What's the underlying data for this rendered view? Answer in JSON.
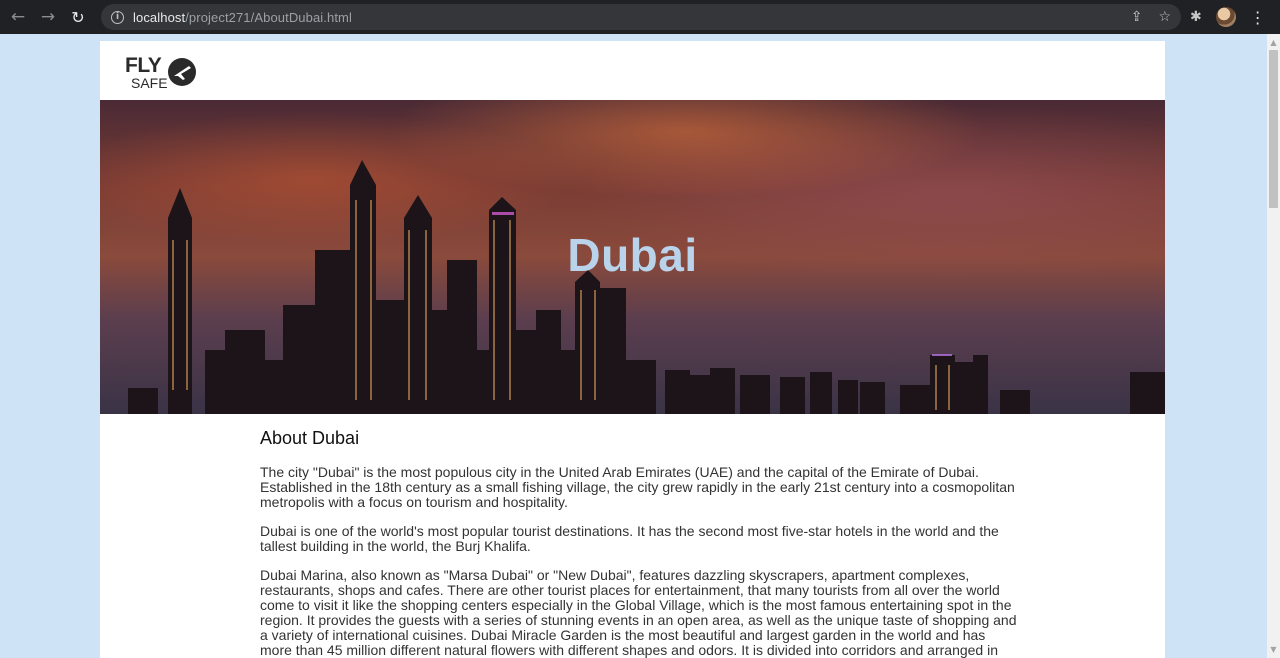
{
  "browser": {
    "url_host": "localhost",
    "url_path": "/project271/AboutDubai.html",
    "icons": {
      "back": "arrow-left-icon",
      "forward": "arrow-right-icon",
      "reload": "reload-icon",
      "info": "info-icon",
      "share": "share-icon",
      "bookmark": "star-icon",
      "extensions": "puzzle-icon",
      "menu": "kebab-menu-icon"
    }
  },
  "logo": {
    "line1": "FLY",
    "line2": "SAFE"
  },
  "hero": {
    "title": "Dubai"
  },
  "about": {
    "heading": "About Dubai",
    "paragraphs": [
      "The city \"Dubai\" is the most populous city in the United Arab Emirates (UAE) and the capital of the Emirate of Dubai. Established in the 18th century as a small fishing village, the city grew rapidly in the early 21st century into a cosmopolitan metropolis with a focus on tourism and hospitality.",
      "Dubai is one of the world's most popular tourist destinations. It has the second most five-star hotels in the world and the tallest building in the world, the Burj Khalifa.",
      "Dubai Marina, also known as \"Marsa Dubai\" or \"New Dubai\", features dazzling skyscrapers, apartment complexes, restaurants, shops and cafes. There are other tourist places for entertainment, that many tourists from all over the world come to visit it like the shopping centers especially in the Global Village, which is the most famous entertaining spot in the region. It provides the guests with a series of stunning events in an open area, as well as the unique taste of shopping and a variety of international cuisines. Dubai Miracle Garden is the most beautiful and largest garden in the world and has more than 45 million different natural flowers with different shapes and odors. It is divided into corridors and arranged in"
    ]
  },
  "colors": {
    "page_bg": "#cfe3f7",
    "hero_title": "#b9d3ea",
    "chrome_bg": "#202124"
  }
}
